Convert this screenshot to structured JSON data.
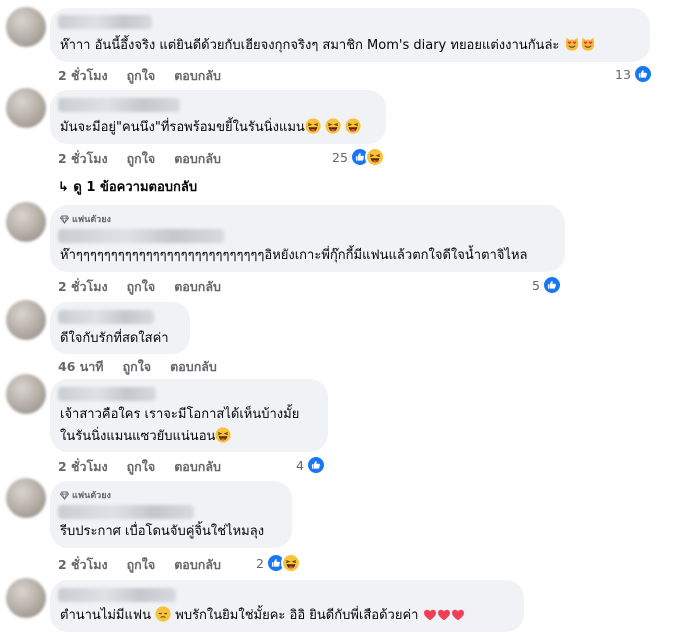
{
  "comments": [
    {
      "text": "ห๊าาา อันนี้อึ้งจริง แต่ยินดีด้วยกับเฮียจงกุกจริงๆ สมาชิก Mom's diary ทยอยแต่งงานกันล่ะ",
      "emoji": [
        "smiling-cat-heart-eyes",
        "smiling-cat-heart-eyes"
      ],
      "time": "2 ชั่วโมง",
      "like": "ถูกใจ",
      "reply": "ตอบกลับ",
      "reaction_count": "13",
      "reactions": [
        "like"
      ]
    },
    {
      "text": "มันจะมีอยู่\"คนนึง\"ที่รอพร้อมขยี้ในรันนิ่งแมน",
      "emoji": [
        "grinning-squinting",
        "grinning-squinting",
        "grinning-squinting"
      ],
      "time": "2 ชั่วโมง",
      "like": "ถูกใจ",
      "reply": "ตอบกลับ",
      "reaction_count": "25",
      "reactions": [
        "like",
        "haha"
      ],
      "view_replies": "ดู 1 ข้อความตอบกลับ"
    },
    {
      "badge": "แฟนตัวยง",
      "text": "ห๊าๆๆๆๆๆๆๆๆๆๆๆๆๆๆๆๆๆๆๆๆๆๆๆๆๆๆๆอิหยังเกาะพี่กุ๊กกี้มีแฟนแล้วตกใจดีใจน้ำตาจิไหล",
      "time": "2 ชั่วโมง",
      "like": "ถูกใจ",
      "reply": "ตอบกลับ",
      "reaction_count": "5",
      "reactions": [
        "like"
      ]
    },
    {
      "text": "ดีใจกับรักที่สดใสค่า",
      "time": "46 นาที",
      "like": "ถูกใจ",
      "reply": "ตอบกลับ"
    },
    {
      "text_line1": "เจ้าสาวคือใคร เราจะมีโอกาสได้เห็นบ้างมั้ย",
      "text_line2": "ในรันนิ่งแมนแซวยับแน่นอน",
      "emoji": [
        "grinning-squinting"
      ],
      "time": "2 ชั่วโมง",
      "like": "ถูกใจ",
      "reply": "ตอบกลับ",
      "reaction_count": "4",
      "reactions": [
        "like"
      ]
    },
    {
      "badge": "แฟนตัวยง",
      "text": "รีบประกาศ เบื่อโดนจับคู่จิ้นใช่ไหมลุง",
      "time": "2 ชั่วโมง",
      "like": "ถูกใจ",
      "reply": "ตอบกลับ",
      "reaction_count": "2",
      "reactions": [
        "like",
        "haha"
      ]
    },
    {
      "text_a": "ตำนานไม่มีแฟน",
      "text_b": "พบรักในยิมใช่มั้ยคะ อิอิ ยินดีกับพี่เสือด้วยค่า",
      "emoji": [
        "pensive-face",
        "heart",
        "heart",
        "heart"
      ]
    }
  ],
  "colors": {
    "bubble": "#f0f2f5",
    "like_blue": "#1877f2",
    "meta_gray": "#65676b",
    "heart_red": "#f33e58"
  }
}
